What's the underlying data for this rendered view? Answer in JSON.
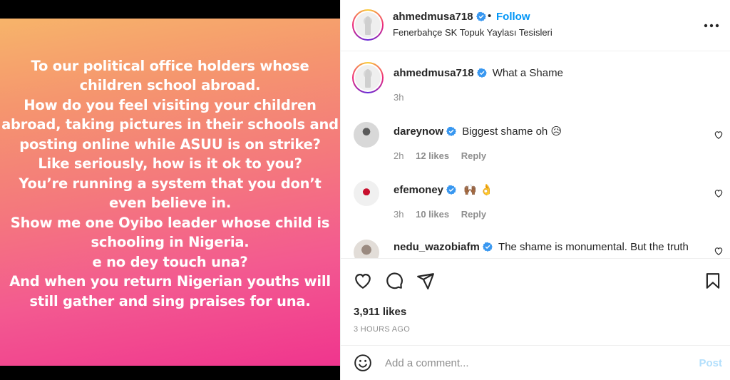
{
  "post": {
    "image_text_lines": [
      "To our political office holders whose",
      "children school abroad.",
      "How do you feel visiting your children",
      "abroad, taking pictures in their schools and",
      "posting online while ASUU is on strike?",
      "Like seriously, how is it ok to you?",
      "You’re running a system that you don’t",
      "even believe in.",
      "Show me one Oyibo leader whose child is",
      "schooling in Nigeria.",
      "e no dey touch una?",
      "And when you return Nigerian youths will",
      "still gather and sing praises for una."
    ]
  },
  "header": {
    "username": "ahmedmusa718",
    "separator": "•",
    "follow_label": "Follow",
    "location": "Fenerbahçe SK Topuk Yaylası Tesisleri",
    "more_icon": "more-horizontal-icon"
  },
  "caption": {
    "username": "ahmedmusa718",
    "text": "What a Shame",
    "time": "3h"
  },
  "comments": [
    {
      "username": "dareynow",
      "text": "Biggest shame oh",
      "emoji": "😥",
      "time": "2h",
      "likes": "12 likes",
      "reply": "Reply"
    },
    {
      "username": "efemoney",
      "text": "",
      "emoji": "🙌🏾 👌",
      "time": "3h",
      "likes": "10 likes",
      "reply": "Reply"
    },
    {
      "username": "nedu_wazobiafm",
      "text": "The shame is monumental. But the truth"
    }
  ],
  "actions": {
    "likes": "3,911 likes",
    "time_ago": "3 HOURS AGO"
  },
  "composer": {
    "placeholder": "Add a comment...",
    "post_label": "Post"
  },
  "colors": {
    "accent": "#0095f6",
    "post_disabled": "#b2dffc",
    "verified": "#3897f0",
    "gradient": [
      "#f7b46a",
      "#f4787d",
      "#f0358e"
    ]
  }
}
